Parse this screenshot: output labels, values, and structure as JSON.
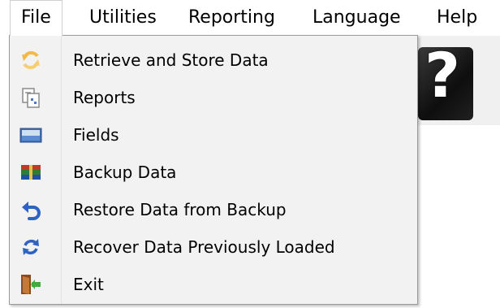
{
  "menubar": {
    "items": [
      "File",
      "Utilities",
      "Reporting",
      "Language",
      "Help"
    ]
  },
  "help_tile": {
    "glyph": "?"
  },
  "file_menu": {
    "items": [
      {
        "label": "Retrieve and Store Data",
        "icon": "refresh-icon"
      },
      {
        "label": "Reports",
        "icon": "report-icon"
      },
      {
        "label": "Fields",
        "icon": "fields-icon"
      },
      {
        "label": "Backup Data",
        "icon": "archive-icon"
      },
      {
        "label": "Restore Data from Backup",
        "icon": "undo-icon"
      },
      {
        "label": "Recover Data Previously Loaded",
        "icon": "sync-icon"
      },
      {
        "label": "Exit",
        "icon": "exit-door-icon"
      }
    ]
  }
}
